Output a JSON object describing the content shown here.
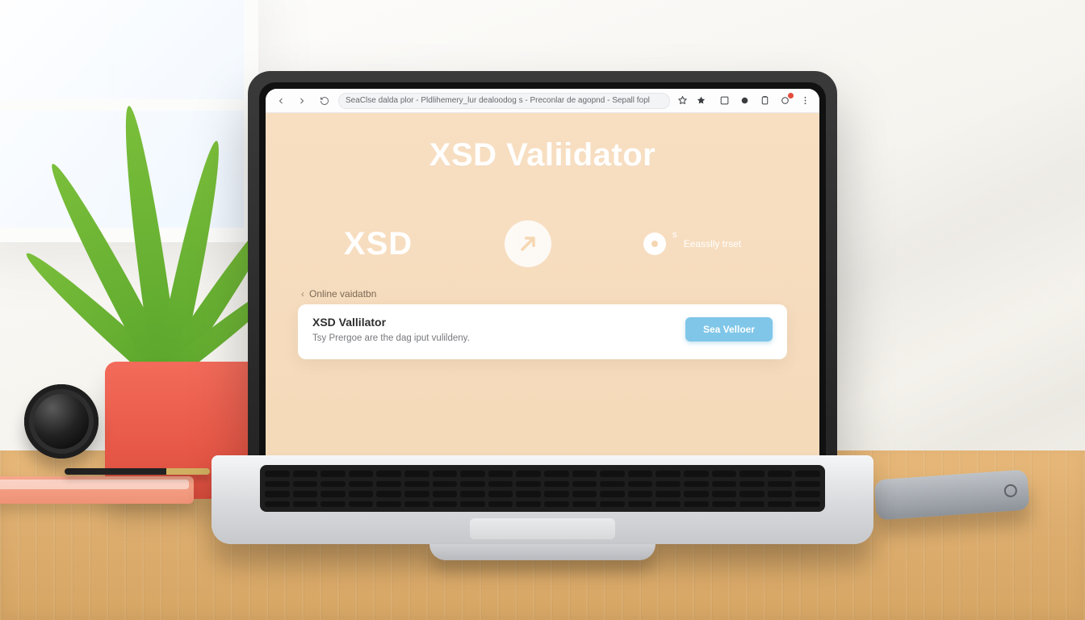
{
  "browser": {
    "omnibox": "SeaClse dalda plor - Pldlihemery_lur dealoodog s - Preconlar de agopnd - Sepall fopl"
  },
  "page": {
    "hero_title": "XSD Valiidator",
    "feature_xsd": "XSD",
    "feature_right_sup": "s",
    "feature_right_caption": "Eeasslly trset",
    "breadcrumb": "Online vaidatbn",
    "card_title": "XSD Vallilator",
    "card_subtitle": "Tsy Prergoe are the dag iput vulildeny.",
    "card_button": "Sea Velloer"
  }
}
